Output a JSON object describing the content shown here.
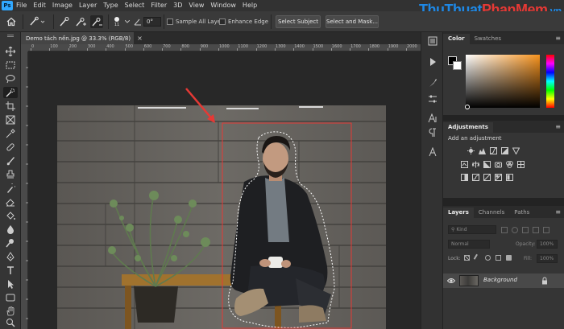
{
  "menubar": {
    "logo": "Ps",
    "items": [
      "File",
      "Edit",
      "Image",
      "Layer",
      "Type",
      "Select",
      "Filter",
      "3D",
      "View",
      "Window",
      "Help"
    ]
  },
  "options": {
    "brush_size": "11",
    "angle": "0°",
    "sample_all_layers": "Sample All Layers",
    "enhance_edge": "Enhance Edge",
    "select_subject": "Select Subject",
    "select_and_mask": "Select and Mask..."
  },
  "document": {
    "tab_title": "Demo tách nền.jpg @ 33.3% (RGB/8)",
    "close": "×"
  },
  "ruler": {
    "labels": [
      "0",
      "100",
      "200",
      "300",
      "400",
      "500",
      "600",
      "700",
      "800",
      "900",
      "1000",
      "1100",
      "1200",
      "1300",
      "1400",
      "1500",
      "1600",
      "1700",
      "1800",
      "1900",
      "2000"
    ]
  },
  "panels": {
    "color_tabs": [
      "Color",
      "Swatches"
    ],
    "adjustments_tab": "Adjustments",
    "add_adjustment": "Add an adjustment",
    "layers_tabs": [
      "Layers",
      "Channels",
      "Paths"
    ],
    "kind_placeholder": "Kind",
    "blend_mode": "Normal",
    "opacity_label": "Opacity:",
    "opacity_value": "100%",
    "lock_label": "Lock:",
    "fill_label": "Fill:",
    "fill_value": "100%",
    "layer_name": "Background"
  },
  "watermark": {
    "text_a": "ThuThuat",
    "text_b": "PhanMem",
    "text_c": ".vn"
  },
  "colors": {
    "accent": "#31a8ff",
    "selection_rect": "#e53935",
    "arrow": "#e53935"
  }
}
